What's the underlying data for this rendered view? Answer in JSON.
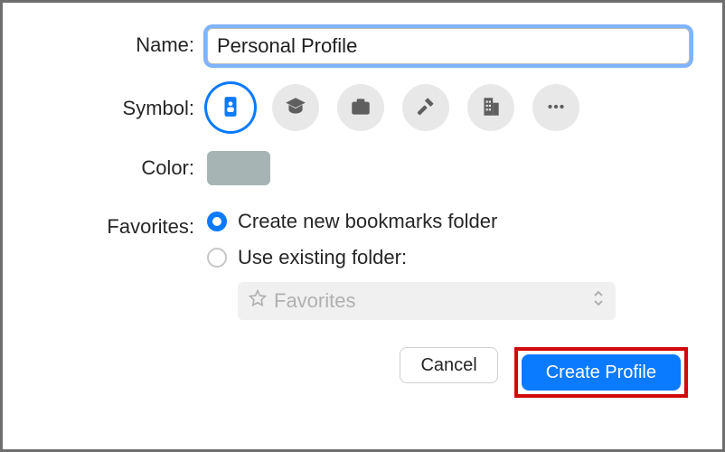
{
  "form": {
    "name_label": "Name:",
    "name_value": "Personal Profile",
    "symbol_label": "Symbol:",
    "symbols": [
      {
        "id": "id-card",
        "selected": true
      },
      {
        "id": "graduation-cap",
        "selected": false
      },
      {
        "id": "briefcase",
        "selected": false
      },
      {
        "id": "hammer",
        "selected": false
      },
      {
        "id": "office-building",
        "selected": false
      },
      {
        "id": "more",
        "selected": false
      }
    ],
    "color_label": "Color:",
    "color_value": "#a7b4b4",
    "favorites_label": "Favorites:",
    "favorites_options": {
      "create_new": "Create new bookmarks folder",
      "use_existing": "Use existing folder:",
      "selected": "create_new",
      "folder_picker_value": "Favorites"
    }
  },
  "buttons": {
    "cancel": "Cancel",
    "create": "Create Profile"
  }
}
